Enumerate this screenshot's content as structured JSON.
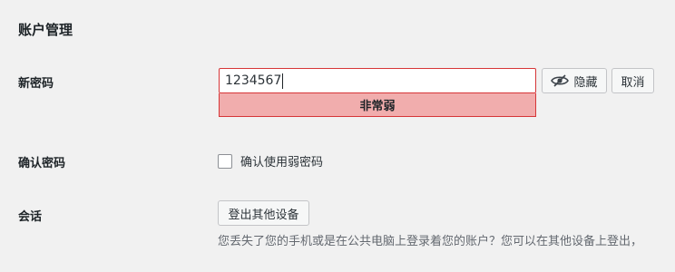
{
  "section_title": "账户管理",
  "new_password": {
    "label": "新密码",
    "value": "1234567",
    "strength": "非常弱",
    "hide_button": "隐藏",
    "cancel_button": "取消"
  },
  "confirm_password": {
    "label": "确认密码",
    "checkbox_label": "确认使用弱密码"
  },
  "sessions": {
    "label": "会话",
    "button": "登出其他设备",
    "description": "您丢失了您的手机或是在公共电脑上登录着您的账户？您可以在其他设备上登出，"
  },
  "colors": {
    "weak_background": "#f1adad",
    "weak_border": "#d63638"
  }
}
